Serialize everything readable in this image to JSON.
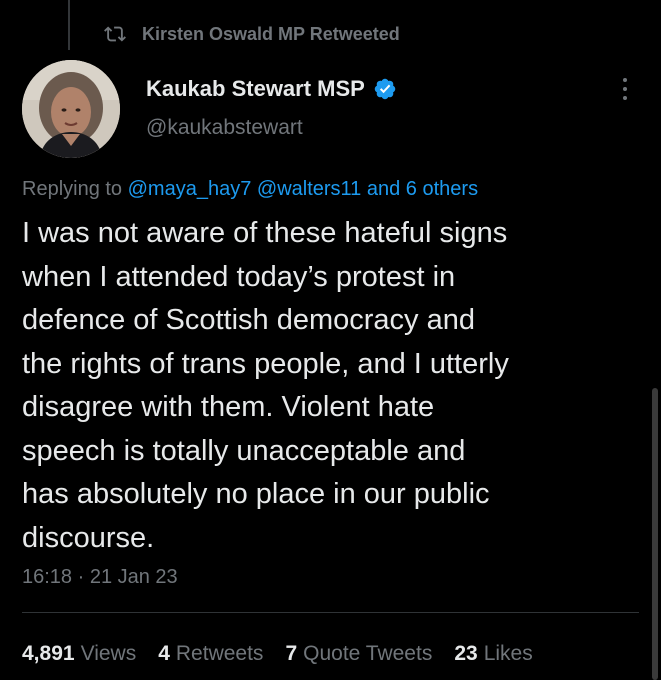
{
  "retweet": {
    "icon": "retweet-icon",
    "text": "Kirsten Oswald MP Retweeted"
  },
  "author": {
    "name": "Kaukab Stewart MSP",
    "handle": "@kaukabstewart",
    "verified_icon": "verified-badge-icon",
    "verified_color": "#1d9bf0"
  },
  "reply": {
    "prefix": "Replying to",
    "mention1": "@maya_hay7",
    "mention2": "@walters11",
    "and_others": "and 6 others"
  },
  "tweet": {
    "lines": [
      "I was not aware of these hateful signs",
      "when I attended today’s protest in",
      "defence of Scottish democracy and",
      "the rights of trans people, and I utterly",
      "disagree with them. Violent hate",
      "speech is totally unacceptable and",
      "has absolutely no place in our public",
      "discourse."
    ]
  },
  "timestamp": "16:18 · 21 Jan 23",
  "stats": {
    "views": {
      "count": "4,891",
      "label": "Views"
    },
    "retweets": {
      "count": "4",
      "label": "Retweets"
    },
    "quotes": {
      "count": "7",
      "label": "Quote Tweets"
    },
    "likes": {
      "count": "23",
      "label": "Likes"
    }
  },
  "colors": {
    "background": "#000000",
    "text_primary": "#e7e9ea",
    "text_secondary": "#71767b",
    "link": "#1d9bf0"
  }
}
